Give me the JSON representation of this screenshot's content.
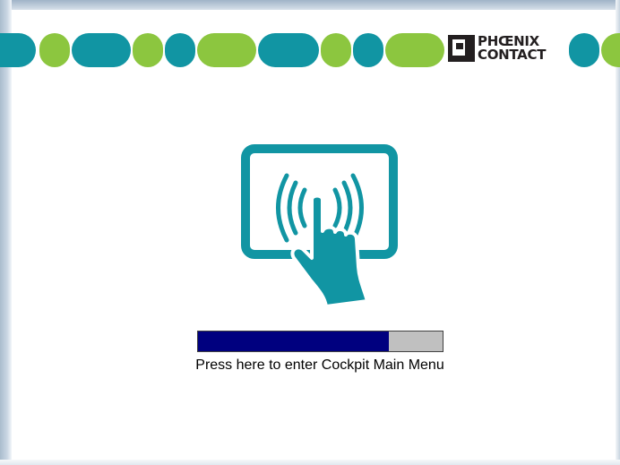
{
  "brand": {
    "logo_line1": "PHŒNIX",
    "logo_line2": "CONTACT"
  },
  "colors": {
    "teal": "#1195a3",
    "green": "#8cc63f",
    "progress_fill": "#00007f",
    "progress_track": "#c0c0c0"
  },
  "icons": {
    "touch": "touch-screen-hand-icon"
  },
  "progress": {
    "fraction": 0.78
  },
  "action": {
    "enter_label": "Press here to enter Cockpit Main Menu"
  }
}
